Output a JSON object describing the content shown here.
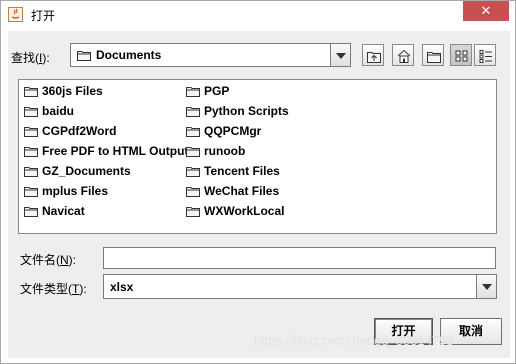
{
  "window": {
    "title": "打开",
    "close_glyph": "✕"
  },
  "lookin": {
    "label_prefix": "查找(",
    "label_key": "I",
    "label_suffix": "):",
    "value": "Documents"
  },
  "toolbar": {
    "buttons": [
      {
        "icon": "up-folder-icon"
      },
      {
        "icon": "home-icon"
      },
      {
        "icon": "new-folder-icon"
      },
      {
        "icon": "list-view-icon",
        "active": true
      },
      {
        "icon": "details-view-icon"
      }
    ]
  },
  "files": {
    "column1": [
      "360js Files",
      "baidu",
      "CGPdf2Word",
      "Free PDF to HTML Output",
      "GZ_Documents",
      "mplus Files",
      "Navicat"
    ],
    "column2": [
      "PGP",
      "Python Scripts",
      "QQPCMgr",
      "runoob",
      "Tencent Files",
      "WeChat Files",
      "WXWorkLocal"
    ]
  },
  "filename": {
    "label_prefix": "文件名(",
    "label_key": "N",
    "label_suffix": "):",
    "value": ""
  },
  "filetype": {
    "label_prefix": "文件类型(",
    "label_key": "T",
    "label_suffix": "):",
    "value": "xlsx"
  },
  "buttons": {
    "open": "打开",
    "cancel": "取消"
  },
  "watermark": "https://blog.csdn.net/qq_33314793",
  "colors": {
    "close_bg": "#c75050",
    "folder": "#f5f5f5"
  }
}
